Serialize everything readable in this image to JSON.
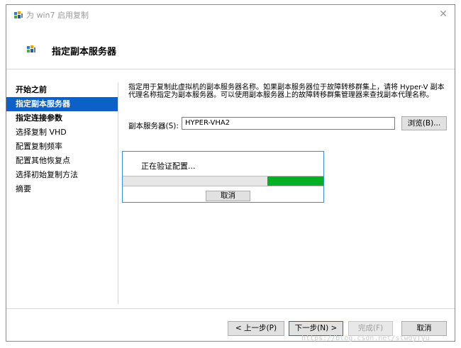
{
  "window": {
    "title": "为 win7 启用复制"
  },
  "header": {
    "title": "指定副本服务器"
  },
  "nav": {
    "items": [
      {
        "label": "开始之前",
        "state": "bold"
      },
      {
        "label": "指定副本服务器",
        "state": "active"
      },
      {
        "label": "指定连接参数",
        "state": "bold"
      },
      {
        "label": "选择复制 VHD",
        "state": "normal"
      },
      {
        "label": "配置复制频率",
        "state": "normal"
      },
      {
        "label": "配置其他恢复点",
        "state": "normal"
      },
      {
        "label": "选择初始复制方法",
        "state": "normal"
      },
      {
        "label": "摘要",
        "state": "normal"
      }
    ]
  },
  "main": {
    "description": "指定用于复制此虚拟机的副本服务器名称。如果副本服务器位于故障转移群集上，请将 Hyper-V 副本代理名称指定为副本服务器。可以使用副本服务器上的故障转移群集管理器来查找副本代理名称。",
    "server_label": "副本服务器(S):",
    "server_value": "HYPER-VHA2",
    "browse_label": "浏览(B)..."
  },
  "progress": {
    "label": "正在验证配置...",
    "cancel_label": "取消",
    "indicator_start": 0.72,
    "indicator_end": 1.0
  },
  "footer": {
    "prev_label": "< 上一步(P)",
    "next_label": "下一步(N) >",
    "finish_label": "完成(F)",
    "cancel_label": "取消"
  },
  "watermark": "https://blog.csdn.net/stwdyfyu",
  "colors": {
    "accent": "#0c61c9",
    "progress": "#06b025"
  }
}
